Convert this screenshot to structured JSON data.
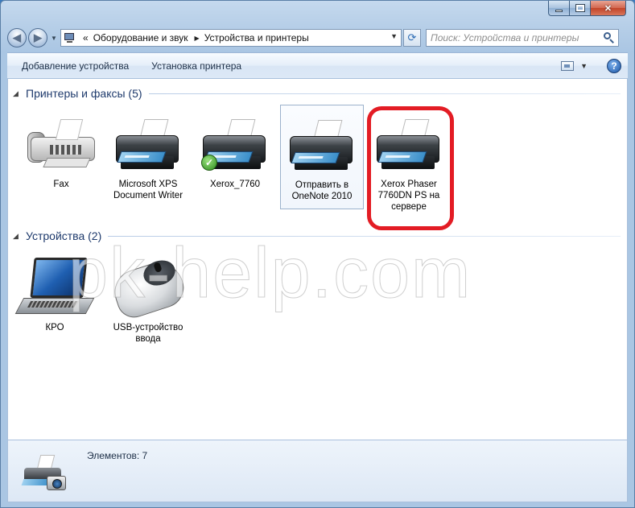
{
  "window": {
    "caption_buttons": [
      "minimize",
      "maximize",
      "close"
    ]
  },
  "navigation": {
    "back_icon": "back-arrow-icon",
    "forward_icon": "forward-arrow-icon",
    "address": {
      "overflow": "«",
      "segments": [
        "Оборудование и звук",
        "Устройства и принтеры"
      ]
    },
    "search_placeholder": "Поиск: Устройства и принтеры"
  },
  "toolbar": {
    "add_device": "Добавление устройства",
    "add_printer": "Установка принтера"
  },
  "groups": [
    {
      "title": "Принтеры и факсы (5)",
      "items": [
        {
          "label": "Fax",
          "icon": "fax-icon"
        },
        {
          "label": "Microsoft XPS Document Writer",
          "icon": "printer-icon"
        },
        {
          "label": "Xerox_7760",
          "icon": "printer-icon",
          "default": true
        },
        {
          "label": "Отправить в OneNote 2010",
          "icon": "printer-icon"
        },
        {
          "label": "Xerox Phaser 7760DN PS на сервере",
          "icon": "printer-icon"
        }
      ]
    },
    {
      "title": "Устройства (2)",
      "items": [
        {
          "label": "КРО",
          "icon": "laptop-icon"
        },
        {
          "label": "USB-устройство ввода",
          "icon": "mouse-icon"
        }
      ]
    }
  ],
  "watermark": "pk-help.com",
  "details": {
    "count": "Элементов: 7"
  },
  "colors": {
    "highlight": "#e31c24",
    "group_title": "#1e3a6c"
  }
}
